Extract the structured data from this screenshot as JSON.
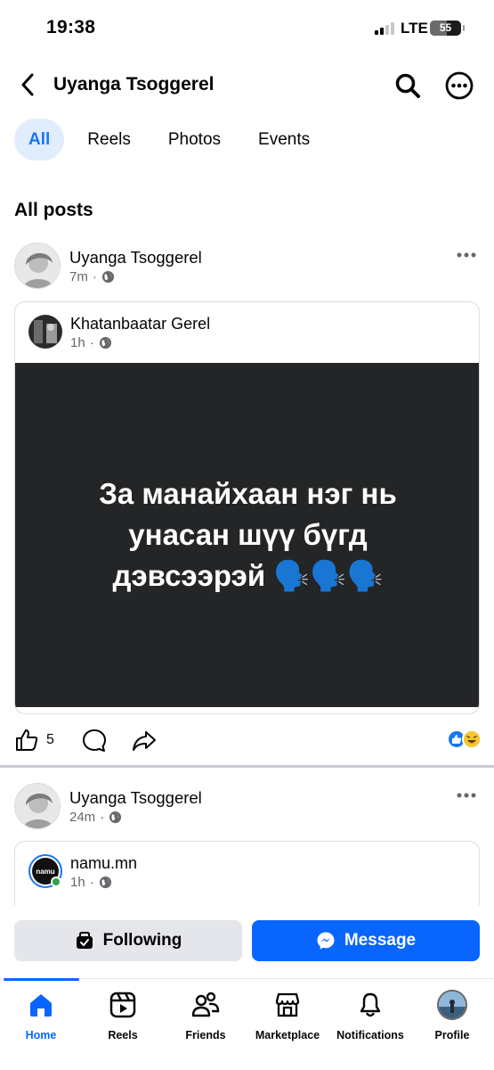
{
  "status_bar": {
    "time": "19:38",
    "network": "LTE",
    "battery": "55",
    "battery_level": 0.55
  },
  "header": {
    "title": "Uyanga Tsoggerel"
  },
  "tabs": [
    {
      "label": "All",
      "active": true
    },
    {
      "label": "Reels",
      "active": false
    },
    {
      "label": "Photos",
      "active": false
    },
    {
      "label": "Events",
      "active": false
    }
  ],
  "section_title": "All posts",
  "posts": [
    {
      "author": "Uyanga Tsoggerel",
      "time": "7m",
      "shared": {
        "author": "Khatanbaatar Gerel",
        "time": "1h",
        "text": "За манайхаан нэг нь унасан шүү бүгд дэвсээрэй 🗣️🗣️🗣️"
      },
      "like_count": "5"
    },
    {
      "author": "Uyanga Tsoggerel",
      "time": "24m",
      "shared": {
        "author": "namu.mn",
        "time": "1h",
        "avatar_text": "namu"
      }
    }
  ],
  "buttons": {
    "following": "Following",
    "message": "Message"
  },
  "nav": [
    {
      "label": "Home",
      "icon": "home-icon",
      "active": true
    },
    {
      "label": "Reels",
      "icon": "reels-icon",
      "active": false
    },
    {
      "label": "Friends",
      "icon": "friends-icon",
      "active": false
    },
    {
      "label": "Marketplace",
      "icon": "marketplace-icon",
      "active": false
    },
    {
      "label": "Notifications",
      "icon": "bell-icon",
      "active": false
    },
    {
      "label": "Profile",
      "icon": "profile-avatar",
      "active": false
    }
  ],
  "colors": {
    "accent": "#0866ff",
    "tab_active_bg": "#e1edfc",
    "text_secondary": "#65676b",
    "post_bg": "#242526"
  }
}
